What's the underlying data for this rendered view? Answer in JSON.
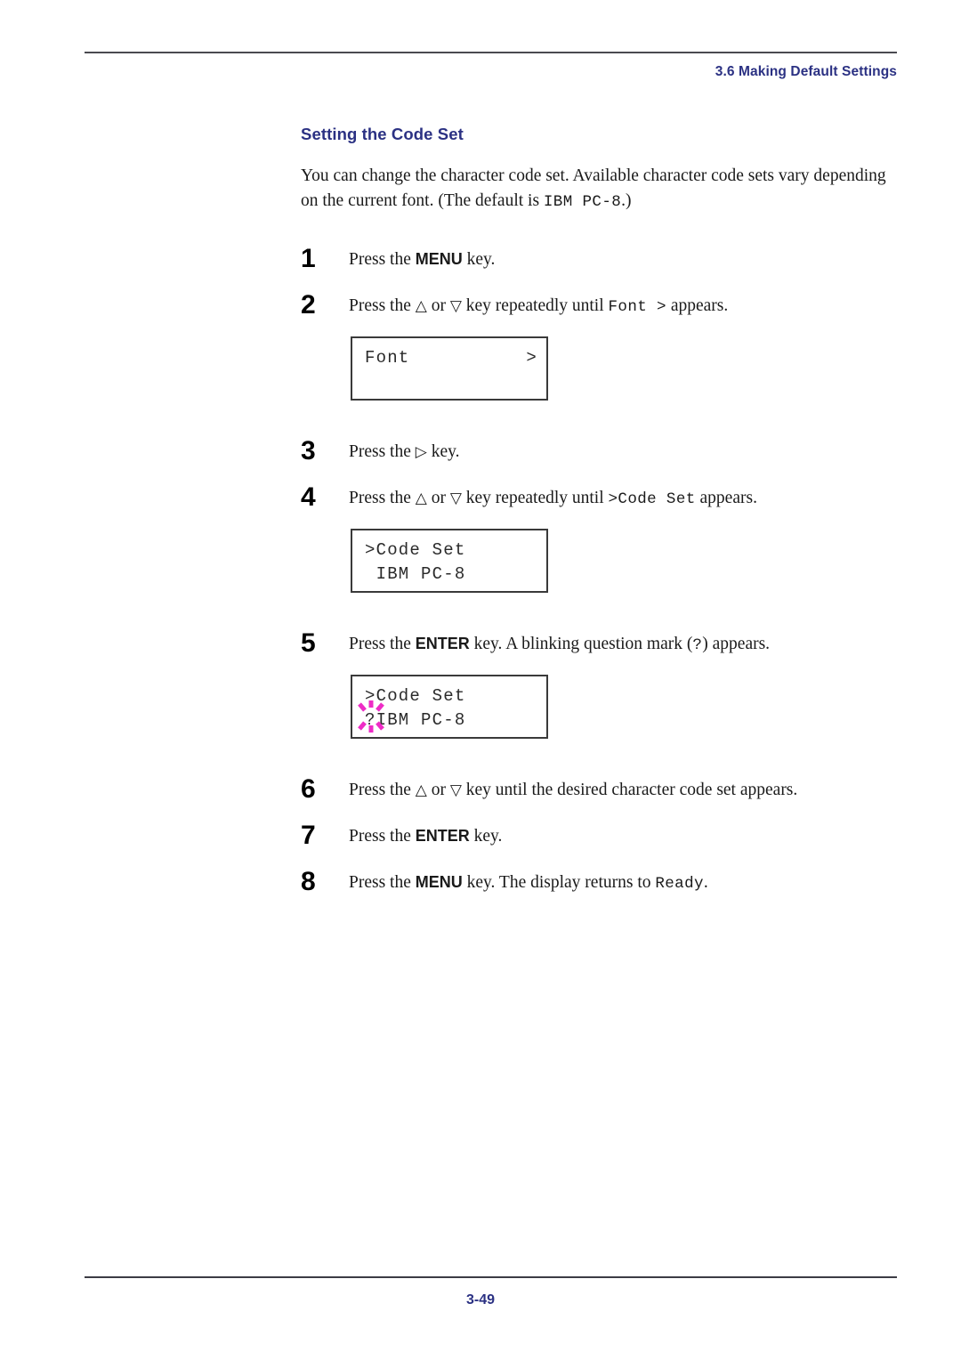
{
  "page": {
    "running_head": "3.6 Making Default Settings",
    "folio": "3-49"
  },
  "section": {
    "title": "Setting the Code Set",
    "intro_part1": "You can change the character code set. Available character code sets vary depending on the current font. (The default is ",
    "intro_mono": "IBM PC-8",
    "intro_part2": ".)"
  },
  "steps": [
    {
      "num": "1",
      "pre": "Press the ",
      "kbd": "MENU",
      "post": " key."
    },
    {
      "num": "2",
      "pre": "Press the ",
      "up": "△",
      "mid": " or ",
      "down": "▽",
      "post": " key repeatedly until ",
      "mono": "Font  >",
      "tail": " appears."
    },
    {
      "num": "3",
      "pre": "Press the ",
      "right": "▷",
      "post": " key."
    },
    {
      "num": "4",
      "pre": "Press the ",
      "up": "△",
      "mid": " or ",
      "down": "▽",
      "post": " key repeatedly until ",
      "mono": ">Code Set",
      "tail": " appears."
    },
    {
      "num": "5",
      "pre": "Press the ",
      "kbd": "ENTER",
      "post": " key. A blinking question mark (",
      "mono": "?",
      "tail": ") appears."
    },
    {
      "num": "6",
      "pre": "Press the ",
      "up": "△",
      "mid": " or ",
      "down": "▽",
      "post": " key until the desired character code set appears."
    },
    {
      "num": "7",
      "pre": "Press the ",
      "kbd": "ENTER",
      "post": " key."
    },
    {
      "num": "8",
      "pre": "Press the ",
      "kbd": "MENU",
      "post": " key. The display returns to ",
      "mono": "Ready",
      "tail": "."
    }
  ],
  "displays": [
    {
      "id": "font-display",
      "line1_left": "Font",
      "line1_right": ">",
      "line2_left": "",
      "line2_right": "",
      "blink": false
    },
    {
      "id": "code-set-display",
      "line1_left": ">Code Set",
      "line1_right": "",
      "line2_left": " IBM PC-8",
      "line2_right": "",
      "blink": false
    },
    {
      "id": "code-set-blinking-display",
      "line1_left": ">Code Set",
      "line1_right": "",
      "line2_left": "?IBM PC-8",
      "line2_right": "",
      "blink": true
    }
  ],
  "colors": {
    "heading_blue": "#2b3183",
    "rule_gray": "#4a4a50",
    "blink_magenta": "#ee2cc6",
    "lcd_border": "#3a3a3a"
  }
}
